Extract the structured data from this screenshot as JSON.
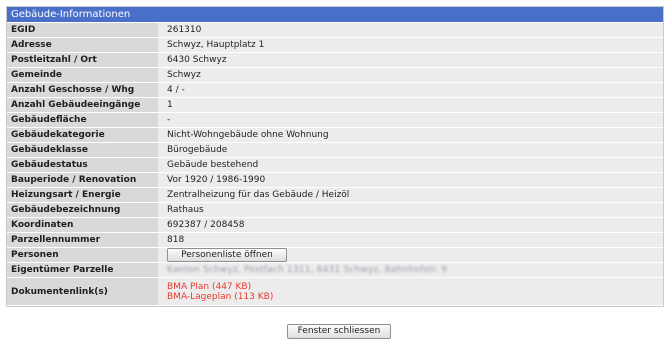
{
  "panel_title": "Gebäude-Informationen",
  "rows": [
    {
      "label": "EGID",
      "value": "261310"
    },
    {
      "label": "Adresse",
      "value": "Schwyz, Hauptplatz 1"
    },
    {
      "label": "Postleitzahl / Ort",
      "value": "6430 Schwyz"
    },
    {
      "label": "Gemeinde",
      "value": "Schwyz"
    },
    {
      "label": "Anzahl Geschosse / Whg",
      "value": "4 / -"
    },
    {
      "label": "Anzahl Gebäudeeingänge",
      "value": "1"
    },
    {
      "label": "Gebäudefläche",
      "value": "-"
    },
    {
      "label": "Gebäudekategorie",
      "value": "Nicht-Wohngebäude ohne Wohnung"
    },
    {
      "label": "Gebäudeklasse",
      "value": "Bürogebäude"
    },
    {
      "label": "Gebäudestatus",
      "value": "Gebäude bestehend"
    },
    {
      "label": "Bauperiode / Renovation",
      "value": "Vor 1920 / 1986-1990"
    },
    {
      "label": "Heizungsart / Energie",
      "value": "Zentralheizung für das Gebäude / Heizöl"
    },
    {
      "label": "Gebäudebezeichnung",
      "value": "Rathaus"
    },
    {
      "label": "Koordinaten",
      "value": "692387 / 208458"
    },
    {
      "label": "Parzellennummer",
      "value": "818"
    }
  ],
  "persons": {
    "label": "Personen",
    "button_label": "Personenliste öffnen"
  },
  "owner": {
    "label": "Eigentümer Parzelle",
    "value": "Kanton Schwyz, Postfach 1311, 6431 Schwyz, Bahnhofstr. 9"
  },
  "documents": {
    "label": "Dokumentenlink(s)",
    "links": [
      "BMA Plan (447 KB)",
      "BMA-Lageplan (113 KB)"
    ]
  },
  "close_button_label": "Fenster schliessen",
  "colors": {
    "title_bar": "#4a6fc9",
    "label_bg": "#d9d9d9",
    "value_bg": "#ececec",
    "link": "#e83b2f"
  }
}
